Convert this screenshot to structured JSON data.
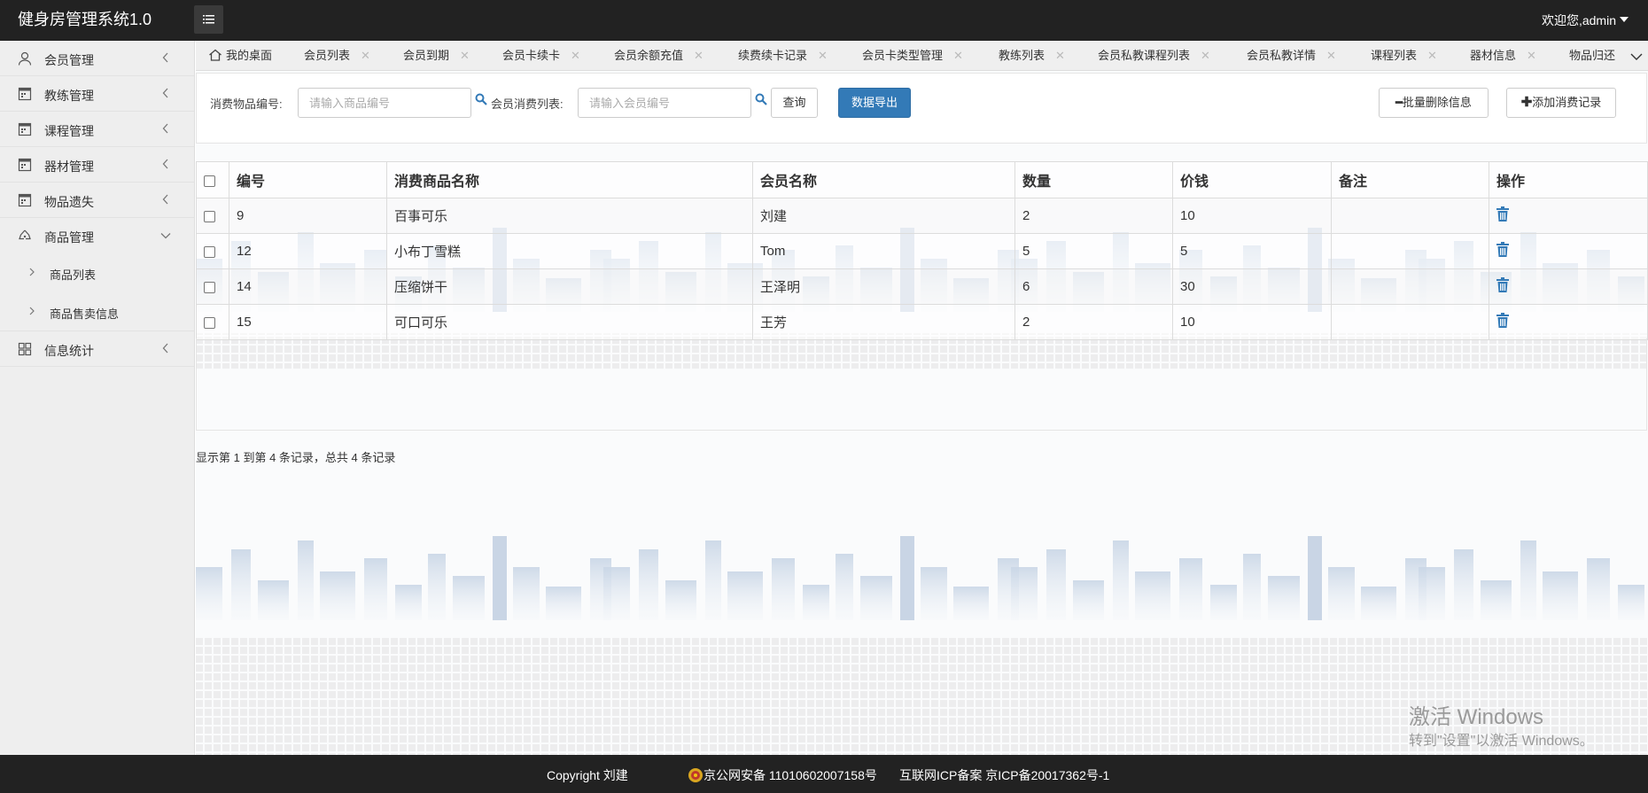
{
  "app": {
    "title": "健身房管理系统1.0",
    "welcome": "欢迎您,admin"
  },
  "sidebar": {
    "items": [
      {
        "label": "会员管理",
        "icon": "user-icon"
      },
      {
        "label": "教练管理",
        "icon": "calendar-icon"
      },
      {
        "label": "课程管理",
        "icon": "calendar-icon"
      },
      {
        "label": "器材管理",
        "icon": "calendar-icon"
      },
      {
        "label": "物品遗失",
        "icon": "calendar-icon"
      },
      {
        "label": "商品管理",
        "icon": "recycle-icon",
        "expanded": true
      },
      {
        "label": "信息统计",
        "icon": "grid-icon"
      }
    ],
    "sub_items": [
      {
        "label": "商品列表"
      },
      {
        "label": "商品售卖信息"
      }
    ]
  },
  "tabs": [
    {
      "label": "我的桌面",
      "icon": "home-icon"
    },
    {
      "label": "会员列表"
    },
    {
      "label": "会员到期"
    },
    {
      "label": "会员卡续卡"
    },
    {
      "label": "会员余额充值"
    },
    {
      "label": "续费续卡记录"
    },
    {
      "label": "会员卡类型管理"
    },
    {
      "label": "教练列表"
    },
    {
      "label": "会员私教课程列表"
    },
    {
      "label": "会员私教详情"
    },
    {
      "label": "课程列表"
    },
    {
      "label": "器材信息"
    },
    {
      "label": "物品归还"
    }
  ],
  "search": {
    "goods_label": "消费物品编号:",
    "goods_placeholder": "请输入商品编号",
    "member_label": "会员消费列表:",
    "member_placeholder": "请输入会员编号",
    "query_button": "查询",
    "export_button": "数据导出",
    "batch_delete_button": "批量删除信息",
    "add_button": "添加消费记录"
  },
  "table": {
    "headers": [
      "编号",
      "消费商品名称",
      "会员名称",
      "数量",
      "价钱",
      "备注",
      "操作"
    ],
    "rows": [
      {
        "id": "9",
        "goods": "百事可乐",
        "member": "刘建",
        "qty": "2",
        "price": "10",
        "note": ""
      },
      {
        "id": "12",
        "goods": "小布丁雪糕",
        "member": "Tom",
        "qty": "5",
        "price": "5",
        "note": ""
      },
      {
        "id": "14",
        "goods": "压缩饼干",
        "member": "王泽明",
        "qty": "6",
        "price": "30",
        "note": ""
      },
      {
        "id": "15",
        "goods": "可口可乐",
        "member": "王芳",
        "qty": "2",
        "price": "10",
        "note": ""
      }
    ]
  },
  "pager": {
    "info": "显示第 1 到第 4 条记录，总共 4 条记录"
  },
  "watermark": {
    "activate_title": "激活 Windows",
    "activate_sub": "转到\"设置\"以激活 Windows。"
  },
  "footer": {
    "copyright": "Copyright 刘建",
    "police": "京公网安备 11010602007158号",
    "icp": "互联网ICP备案 京ICP备20017362号-1"
  },
  "colors": {
    "header_bg": "#222222",
    "primary": "#337ab7",
    "delete_icon": "#337ab7",
    "sidebar_bg": "#eeeeee"
  }
}
